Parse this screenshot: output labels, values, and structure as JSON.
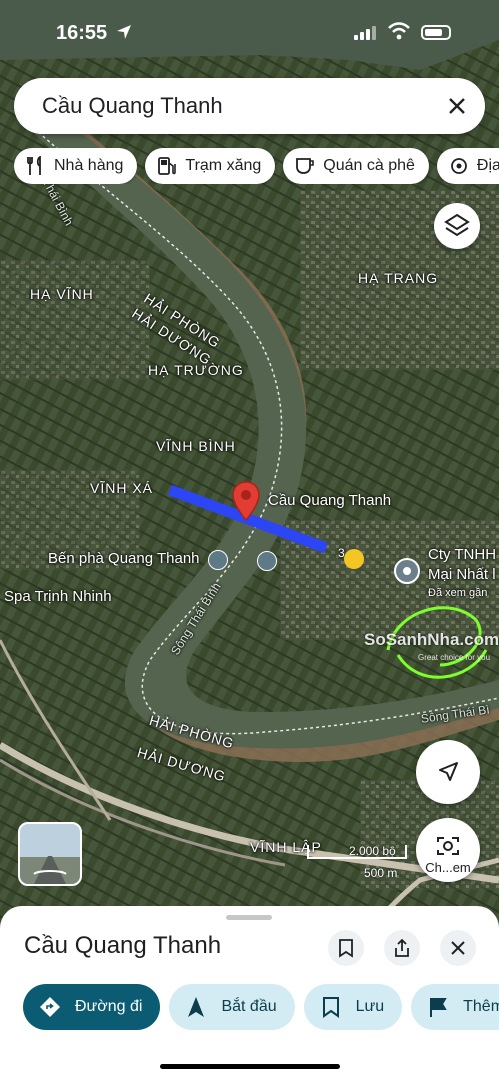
{
  "status_bar": {
    "time": "16:55"
  },
  "search": {
    "query": "Cầu Quang Thanh"
  },
  "chips": [
    {
      "label": "Nhà hàng",
      "icon": "restaurant-icon"
    },
    {
      "label": "Trạm xăng",
      "icon": "gas-station-icon"
    },
    {
      "label": "Quán cà phê",
      "icon": "coffee-icon"
    },
    {
      "label": "Địa",
      "icon": "attraction-icon"
    }
  ],
  "map": {
    "labels": {
      "ha_vinh": "HẠ VĨNH",
      "ha_trang": "HẠ TRANG",
      "ha_truong": "HẠ TRƯỜNG",
      "vinh_binh": "VĨNH BÌNH",
      "vinh_xa": "VĨNH XÁ",
      "vinh_lap": "VĨNH LẬP",
      "hai_phong_top": "HẢI PHÒNG",
      "hai_duong_top": "HẢI DƯƠNG",
      "hai_phong_bottom": "HẢI PHÒNG",
      "hai_duong_bottom": "HẢI DƯƠNG",
      "thai_binh_top": "Thái Bình",
      "river_left": "Sông Thái Bình",
      "river_right": "Sông Thái Bì"
    },
    "places": {
      "bridge": "Cầu Quang Thanh",
      "ferry": "Bến phà Quang Thanh",
      "spa": "Spa Trịnh Nhinh",
      "company_line1": "Cty TNHH",
      "company_line2": "Mại Nhất l",
      "company_line3": "Đã xem gần",
      "poi_number": "3"
    },
    "scale": {
      "feet": "2.000 bộ",
      "meters": "500 m"
    },
    "watermark": {
      "brand": "SoSanhNha.com",
      "tagline": "Great choice for you"
    },
    "controls": {
      "lens_label": "Ch...em"
    }
  },
  "place_sheet": {
    "title": "Cầu Quang Thanh",
    "actions": [
      {
        "label": "Đường đi",
        "icon": "directions-icon"
      },
      {
        "label": "Bắt đầu",
        "icon": "navigation-arrow-icon"
      },
      {
        "label": "Lưu",
        "icon": "bookmark-icon"
      },
      {
        "label": "Thêm",
        "icon": "flag-icon"
      }
    ]
  },
  "colors": {
    "route_line": "#2c45f5",
    "pin": "#e23d32",
    "primary_action": "#0b5b73",
    "secondary_action": "#d3ecf3"
  }
}
